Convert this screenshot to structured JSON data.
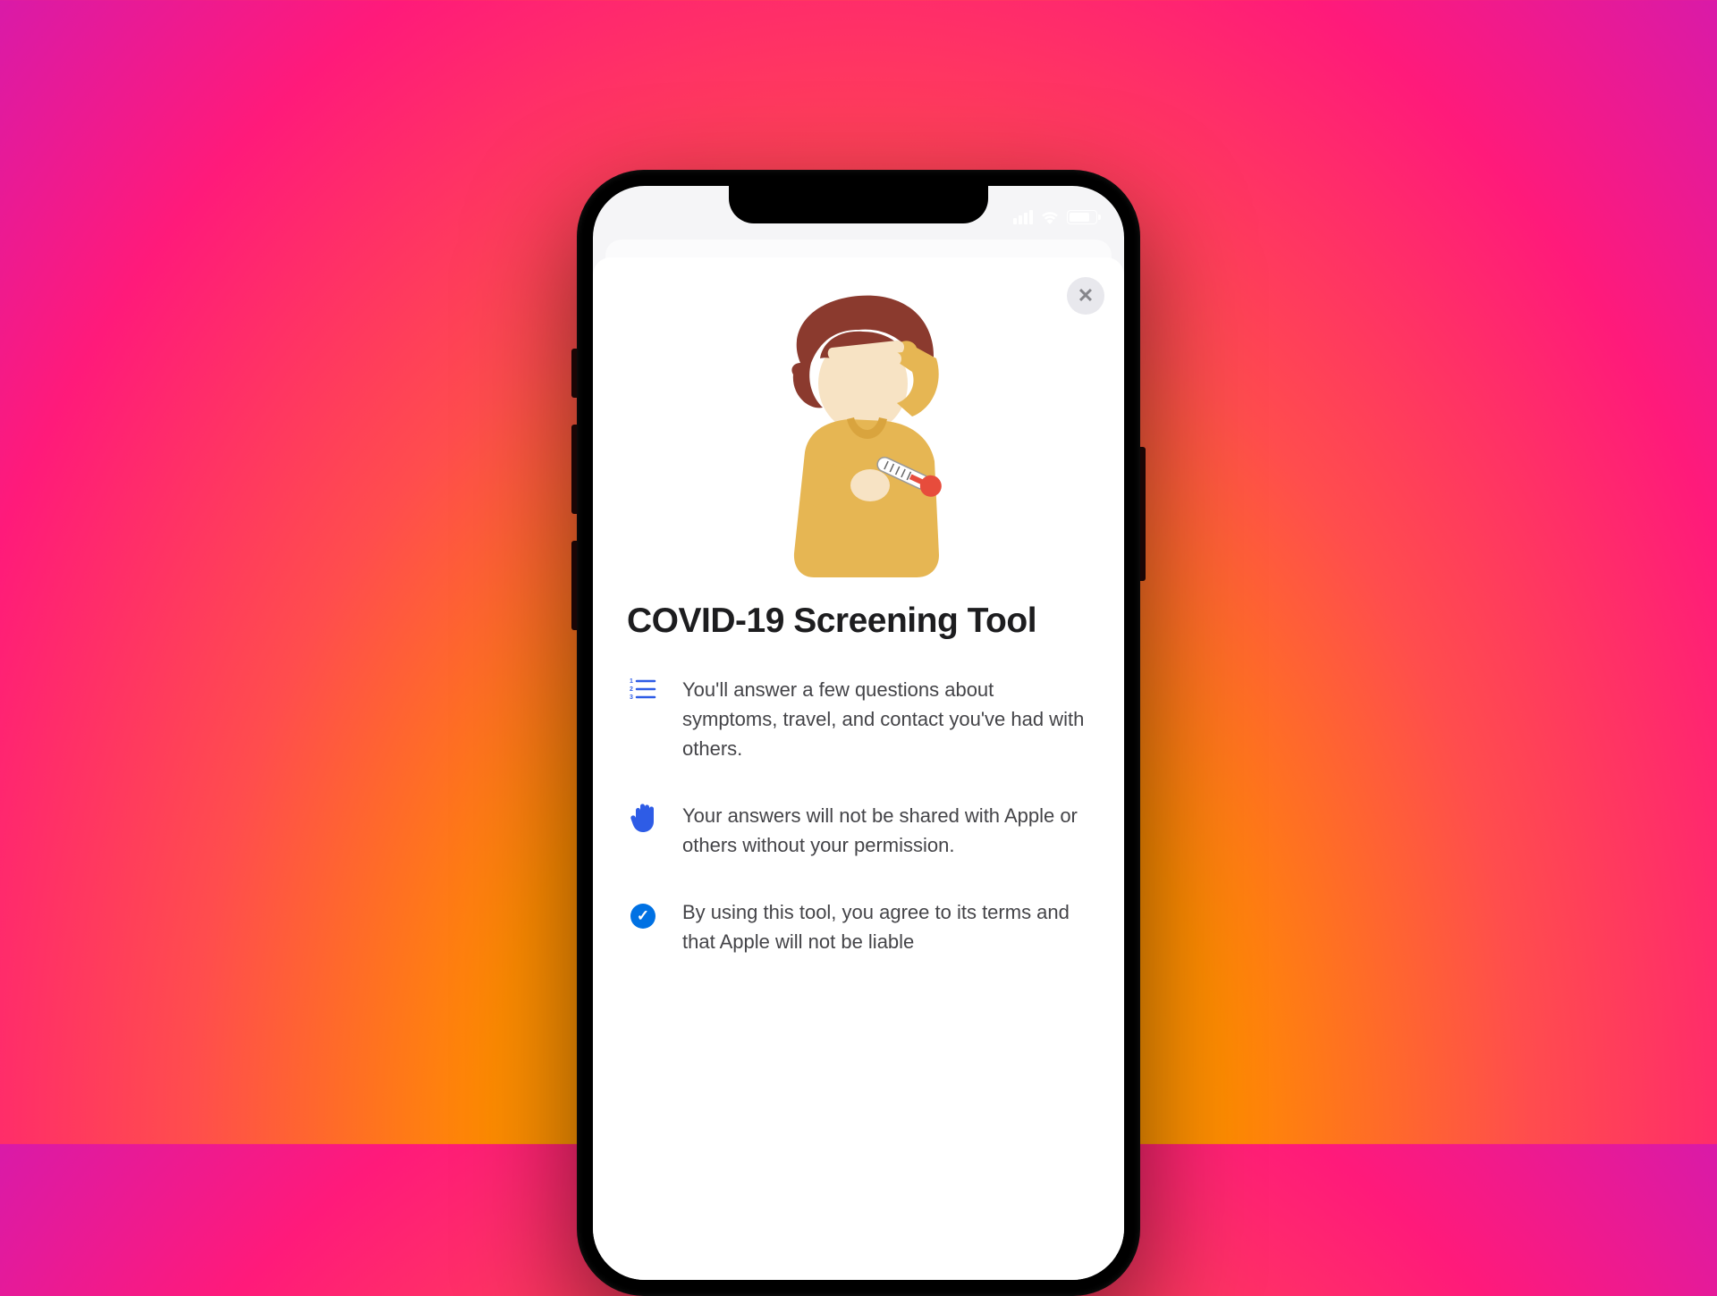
{
  "screen": {
    "title": "COVID-19 Screening Tool",
    "info_items": [
      {
        "icon": "numbered-list-icon",
        "text": "You'll answer a few questions about symptoms, travel, and contact you've had with others."
      },
      {
        "icon": "hand-stop-icon",
        "text": "Your answers will not be shared with Apple or others without your permission."
      },
      {
        "icon": "checkmark-circle-icon",
        "text": "By using this tool, you agree to its terms and that Apple will not be liable"
      }
    ]
  }
}
